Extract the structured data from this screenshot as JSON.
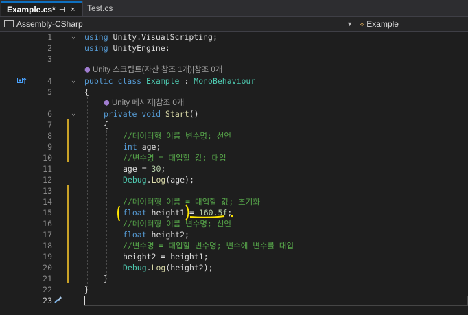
{
  "tabs": [
    {
      "label": "Example.cs*",
      "pin_glyph": "⊣",
      "close_glyph": "×"
    },
    {
      "label": "Test.cs"
    }
  ],
  "navbar": {
    "project": "Assembly-CSharp",
    "class_name": "Example"
  },
  "editor": {
    "line_numbers": [
      "1",
      "2",
      "3",
      "4",
      "5",
      "6",
      "7",
      "8",
      "9",
      "10",
      "11",
      "12",
      "13",
      "14",
      "15",
      "16",
      "17",
      "18",
      "19",
      "20",
      "21",
      "22",
      "23"
    ],
    "codelens": {
      "class_refs": "Unity 스크립트(자산 참조 1개)|참조 0개",
      "method_refs": "Unity 메시지|참조 0개"
    },
    "lines": {
      "l1_kw": "using",
      "l1_ns": " Unity.VisualScripting;",
      "l2_kw": "using",
      "l2_ns": " UnityEngine;",
      "l4_kw": "public class",
      "l4_name": " Example",
      "l4_colon": " : ",
      "l4_base": "MonoBehaviour",
      "l5": "{",
      "l6_kw": "private void",
      "l6_fn": " Start",
      "l6_rest": "()",
      "l7": "{",
      "l8": "//데이터형 이름 변수명; 선언",
      "l9_kw": "int",
      "l9_rest": " age;",
      "l10": "//변수명 = 대입할 값; 대입",
      "l11_a": "age = ",
      "l11_num": "30",
      "l11_b": ";",
      "l12_ty": "Debug",
      "l12_dot": ".",
      "l12_fn": "Log",
      "l12_rest": "(age);",
      "l14": "//데이터형 이름 = 대입할 값; 초기화",
      "l15_kw": "float",
      "l15_a": " height1 = ",
      "l15_num": "160.5f",
      "l15_b": ";",
      "l16": "//데이터형 이름 변수명; 선언",
      "l17_kw": "float",
      "l17_rest": " height2;",
      "l18": "//변수명 = 대입할 변수명; 변수에 변수를 대입",
      "l19": "height2 = height1;",
      "l20_ty": "Debug",
      "l20_dot": ".",
      "l20_fn": "Log",
      "l20_rest": "(height2);",
      "l21": "}",
      "l22": "}"
    }
  },
  "colors": {
    "keyword": "#569cd6",
    "type": "#4ec9b0",
    "method": "#dcdcaa",
    "number": "#b5cea8",
    "comment": "#57a64a",
    "annotation": "#ffe600",
    "change_bar": "#c9a227"
  }
}
